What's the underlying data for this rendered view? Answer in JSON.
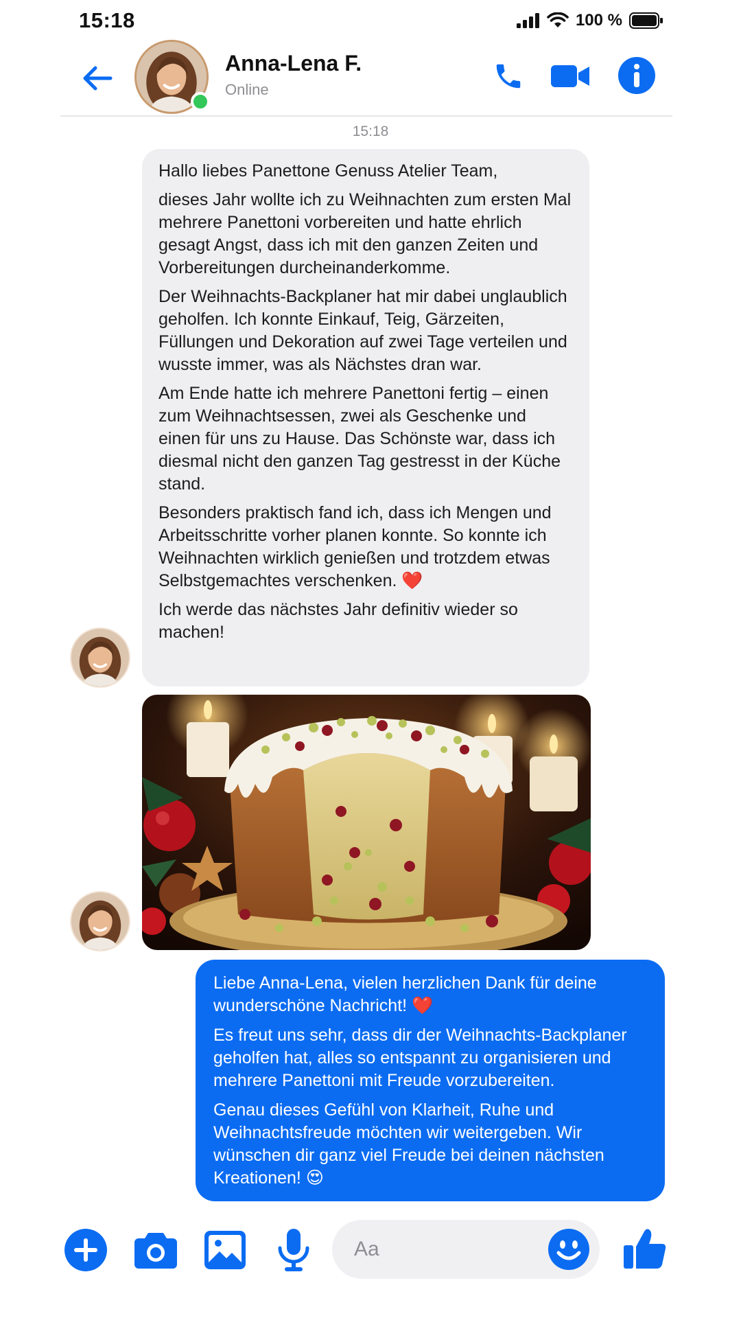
{
  "status_bar": {
    "time": "15:18",
    "battery_text": "100 %"
  },
  "header": {
    "contact_name": "Anna-Lena F.",
    "contact_status": "Online"
  },
  "conversation": {
    "timestamp": "15:18",
    "incoming_message": {
      "paragraphs": [
        "Hallo liebes Panettone Genuss Atelier Team,",
        "dieses Jahr wollte ich zu Weihnachten zum ersten Mal mehrere Panettoni vorbereiten und hatte ehrlich gesagt Angst, dass ich mit den ganzen Zeiten und Vorbereitungen durcheinanderkomme.",
        "Der Weihnachts-Backplaner hat mir dabei unglaublich geholfen. Ich konnte Einkauf, Teig, Gärzeiten, Füllungen und Dekoration auf zwei Tage verteilen und wusste immer, was als Nächstes dran war.",
        "Am Ende hatte ich mehrere Panettoni fertig – einen zum Weihnachtsessen, zwei als Geschenke und einen für uns zu Hause. Das Schönste war, dass ich diesmal nicht den ganzen Tag gestresst in der Küche stand.",
        "Besonders praktisch fand ich, dass ich Mengen und Arbeitsschritte vorher planen konnte. So konnte ich Weihnachten wirklich genießen und trotzdem etwas Selbstgemachtes verschenken. ❤️",
        "Ich werde das nächstes Jahr definitiv wieder so machen!"
      ]
    },
    "outgoing_message": {
      "paragraphs": [
        "Liebe Anna-Lena, vielen herzlichen Dank für deine wunderschöne Nachricht! ❤️",
        "Es freut uns sehr, dass dir der Weihnachts-Backplaner geholfen hat, alles so entspannt zu organisieren und mehrere Panettoni mit Freude vorzubereiten.",
        "Genau dieses Gefühl von Klarheit, Ruhe und Weihnachtsfreude möchten wir weitergeben. Wir wünschen dir ganz viel Freude bei deinen nächsten Kreationen! 😍"
      ]
    }
  },
  "composer": {
    "placeholder": "Aa"
  },
  "colors": {
    "accent": "#0b6cf2",
    "online": "#34c759",
    "incoming_bubble": "#efeff1"
  },
  "icons": [
    "back-arrow-icon",
    "phone-icon",
    "video-camera-icon",
    "info-icon",
    "plus-icon",
    "camera-icon",
    "image-icon",
    "microphone-icon",
    "smiley-icon",
    "thumbs-up-icon"
  ]
}
